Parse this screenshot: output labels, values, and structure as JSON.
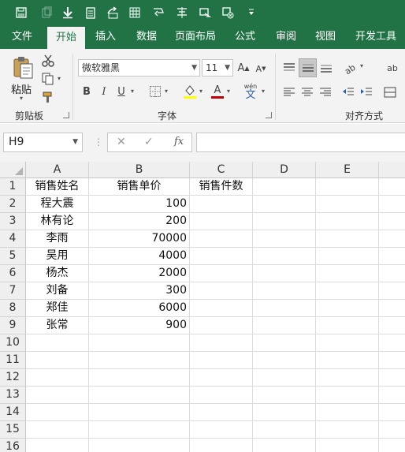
{
  "colors": {
    "brand": "#217346",
    "ribbon_bg": "#f3f3f3",
    "font_color_bar": "#c00000",
    "fill_color_bar": "#ffff00"
  },
  "quick_access": {
    "icons": [
      "save-icon",
      "undo-icon",
      "download-icon",
      "clipboard-icon",
      "share-icon",
      "column-insert-icon",
      "shape-icon",
      "align-icon",
      "forward-icon",
      "delete-icon",
      "customize-dropdown-icon"
    ]
  },
  "tabs": [
    {
      "label": "文件"
    },
    {
      "label": "开始",
      "active": true
    },
    {
      "label": "插入"
    },
    {
      "label": "数据"
    },
    {
      "label": "页面布局"
    },
    {
      "label": "公式"
    },
    {
      "label": "审阅"
    },
    {
      "label": "视图"
    },
    {
      "label": "开发工具"
    }
  ],
  "ribbon": {
    "clipboard": {
      "paste_label": "粘贴",
      "group_label": "剪贴板"
    },
    "font": {
      "font_name": "微软雅黑",
      "font_size": "11",
      "group_label": "字体",
      "bold": "B",
      "italic": "I",
      "underline": "U",
      "grow": "A",
      "shrink": "A",
      "font_color_letter": "A",
      "phonetic": "wén"
    },
    "alignment": {
      "group_label": "对齐方式",
      "wrap_partial": "ab"
    }
  },
  "formula_bar": {
    "name_box": "H9",
    "fx_label": "fx",
    "formula": ""
  },
  "sheet": {
    "columns": [
      "A",
      "B",
      "C",
      "D",
      "E"
    ],
    "rows": [
      "1",
      "2",
      "3",
      "4",
      "5",
      "6",
      "7",
      "8",
      "9",
      "10",
      "11",
      "12",
      "13",
      "14",
      "15",
      "16"
    ],
    "header": {
      "A": "销售姓名",
      "B": "销售单价",
      "C": "销售件数"
    },
    "data": [
      {
        "name": "程大震",
        "price": "100"
      },
      {
        "name": "林有论",
        "price": "200"
      },
      {
        "name": "李雨",
        "price": "70000"
      },
      {
        "name": "吴用",
        "price": "4000"
      },
      {
        "name": "杨杰",
        "price": "2000"
      },
      {
        "name": "刘备",
        "price": "300"
      },
      {
        "name": "郑佳",
        "price": "6000"
      },
      {
        "name": "张常",
        "price": "900"
      }
    ]
  }
}
